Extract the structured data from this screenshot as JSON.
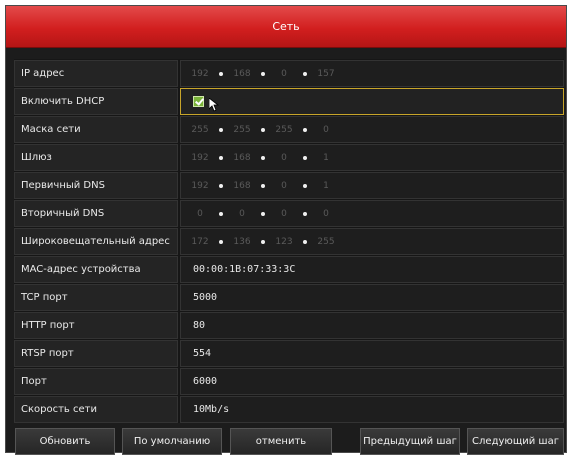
{
  "window": {
    "title": "Сеть"
  },
  "rows": [
    {
      "label": "IP адрес",
      "type": "ip",
      "octets": [
        "192",
        "168",
        "0",
        "157"
      ]
    },
    {
      "label": "Включить DHCP",
      "type": "checkbox",
      "checked": true
    },
    {
      "label": "Маска сети",
      "type": "ip",
      "octets": [
        "255",
        "255",
        "255",
        "0"
      ]
    },
    {
      "label": "Шлюз",
      "type": "ip",
      "octets": [
        "192",
        "168",
        "0",
        "1"
      ]
    },
    {
      "label": "Первичный DNS",
      "type": "ip",
      "octets": [
        "192",
        "168",
        "0",
        "1"
      ]
    },
    {
      "label": "Вторичный DNS",
      "type": "ip",
      "octets": [
        "0",
        "0",
        "0",
        "0"
      ]
    },
    {
      "label": "Широковещательный адрес",
      "type": "ip",
      "octets": [
        "172",
        "136",
        "123",
        "255"
      ]
    },
    {
      "label": "MAC-адрес устройства",
      "type": "text",
      "value": "00:00:1B:07:33:3C"
    },
    {
      "label": "TCP порт",
      "type": "text",
      "value": "5000"
    },
    {
      "label": "HTTP порт",
      "type": "text",
      "value": "80"
    },
    {
      "label": "RTSP порт",
      "type": "text",
      "value": "554"
    },
    {
      "label": "Порт",
      "type": "text",
      "value": "6000"
    },
    {
      "label": "Скорость сети",
      "type": "text",
      "value": "10Mb/s"
    }
  ],
  "buttons": {
    "refresh": "Обновить",
    "default": "По умолчанию",
    "cancel": "отменить",
    "prev": "Предыдущий шаг",
    "next": "Следующий шаг"
  },
  "colors": {
    "title_bar": "#d21f1f",
    "focus_border": "#c8a52a",
    "checkbox": "#7ab33a"
  },
  "icons": {
    "pointer": "mouse-pointer-icon"
  }
}
